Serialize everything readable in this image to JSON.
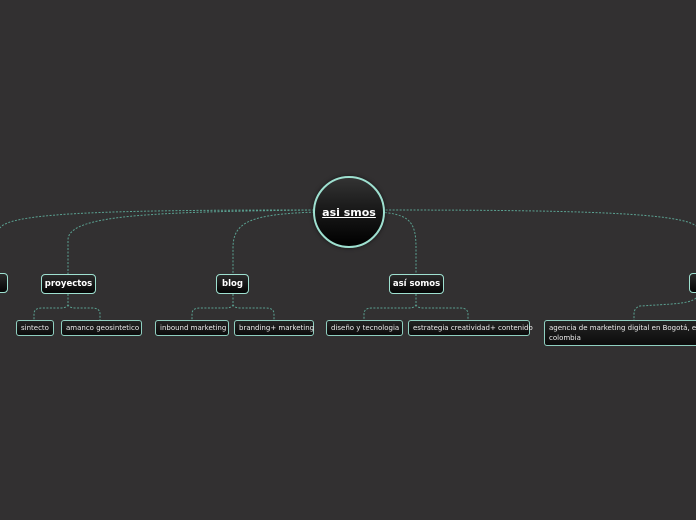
{
  "root": {
    "label": "asi smos"
  },
  "topics": [
    {
      "id": "left-edge",
      "label": ""
    },
    {
      "id": "proyectos",
      "label": "proyectos"
    },
    {
      "id": "blog",
      "label": "blog"
    },
    {
      "id": "asi-somos",
      "label": "así somos"
    },
    {
      "id": "right-edge",
      "label": ""
    }
  ],
  "subtopics": [
    {
      "parent": "proyectos",
      "label": "sintecto"
    },
    {
      "parent": "proyectos",
      "label": "amanco geosintetico"
    },
    {
      "parent": "blog",
      "label": "inbound marketing"
    },
    {
      "parent": "blog",
      "label": "branding+ marketing"
    },
    {
      "parent": "asi-somos",
      "label": "diseño y tecnologia"
    },
    {
      "parent": "asi-somos",
      "label": "estrategia creatividad+ contenido"
    },
    {
      "parent": "right-edge",
      "label": "agencia de marketing digital en Bogotá, en colombia"
    }
  ],
  "colors": {
    "background": "#323031",
    "connector": "#5fae9c",
    "border": "#9ee0d0",
    "text": "#ffffff"
  }
}
